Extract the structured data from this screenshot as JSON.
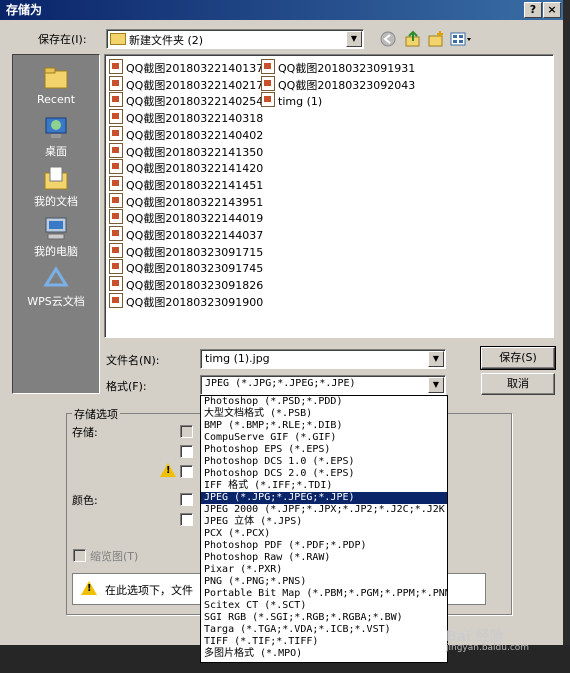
{
  "window": {
    "title": "存储为",
    "help_label": "?",
    "close_label": "×"
  },
  "save_in": {
    "label": "保存在(I):",
    "value": "新建文件夹 (2)"
  },
  "toolbar_icons": [
    "back-icon",
    "up-folder-icon",
    "new-folder-icon",
    "view-menu-icon"
  ],
  "places": [
    {
      "label": "Recent",
      "icon": "recent-icon"
    },
    {
      "label": "桌面",
      "icon": "desktop-icon"
    },
    {
      "label": "我的文档",
      "icon": "my-documents-icon"
    },
    {
      "label": "我的电脑",
      "icon": "my-computer-icon"
    },
    {
      "label": "WPS云文档",
      "icon": "wps-cloud-icon"
    }
  ],
  "files_col1": [
    "QQ截图20180322140137",
    "QQ截图20180322140217",
    "QQ截图20180322140254",
    "QQ截图20180322140318",
    "QQ截图20180322140402",
    "QQ截图20180322141350",
    "QQ截图20180322141420",
    "QQ截图20180322141451",
    "QQ截图20180322143951",
    "QQ截图20180322144019",
    "QQ截图20180322144037",
    "QQ截图20180323091715",
    "QQ截图20180323091745",
    "QQ截图20180323091826",
    "QQ截图20180323091900"
  ],
  "files_col2": [
    "QQ截图20180323091931",
    "QQ截图20180323092043",
    "timg (1)"
  ],
  "filename": {
    "label": "文件名(N):",
    "value": "timg (1).jpg"
  },
  "format": {
    "label": "格式(F):",
    "value": "JPEG (*.JPG;*.JPEG;*.JPE)"
  },
  "buttons": {
    "save": "保存(S)",
    "cancel": "取消"
  },
  "options": {
    "group_title": "存储选项",
    "save_label": "存储:",
    "color_label": "颜色:",
    "thumbnail_label": "缩览图(T)",
    "warning_text": "在此选项下，文件"
  },
  "format_options": [
    "Photoshop (*.PSD;*.PDD)",
    "大型文档格式 (*.PSB)",
    "BMP (*.BMP;*.RLE;*.DIB)",
    "CompuServe GIF (*.GIF)",
    "Photoshop EPS (*.EPS)",
    "Photoshop DCS 1.0 (*.EPS)",
    "Photoshop DCS 2.0 (*.EPS)",
    "IFF 格式 (*.IFF;*.TDI)",
    "JPEG (*.JPG;*.JPEG;*.JPE)",
    "JPEG 2000 (*.JPF;*.JPX;*.JP2;*.J2C;*.J2K",
    "JPEG 立体 (*.JPS)",
    "PCX (*.PCX)",
    "Photoshop PDF (*.PDF;*.PDP)",
    "Photoshop Raw (*.RAW)",
    "Pixar (*.PXR)",
    "PNG (*.PNG;*.PNS)",
    "Portable Bit Map (*.PBM;*.PGM;*.PPM;*.PNM",
    "Scitex CT (*.SCT)",
    "SGI RGB (*.SGI;*.RGB;*.RGBA;*.BW)",
    "Targa (*.TGA;*.VDA;*.ICB;*.VST)",
    "TIFF (*.TIF;*.TIFF)",
    "多图片格式 (*.MPO)"
  ],
  "selected_format_index": 8,
  "watermark": {
    "brand": "Bai 经验",
    "url": "jingyan.baidu.com"
  }
}
